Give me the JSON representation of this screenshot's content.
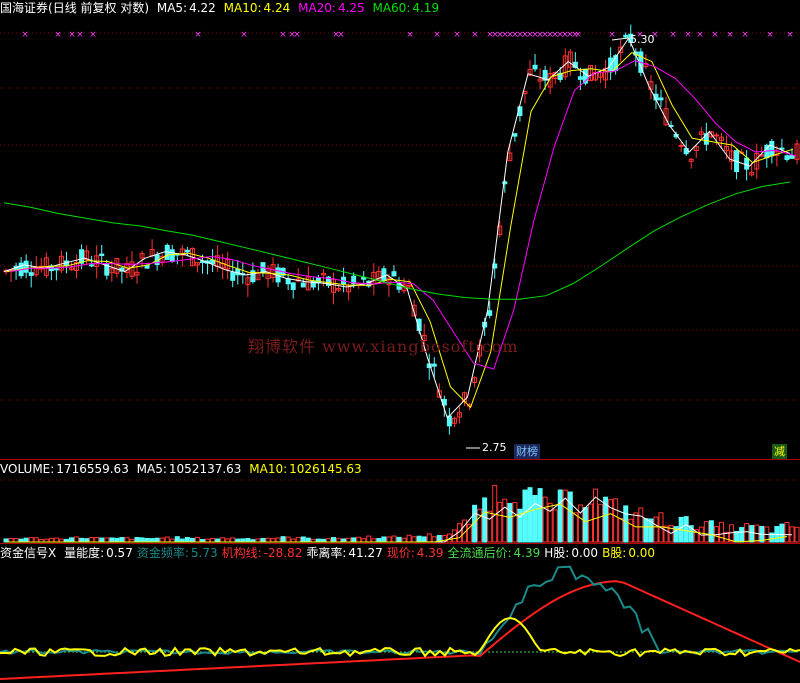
{
  "header": {
    "name": "国海证券",
    "period": "(日线 前复权 对数)",
    "ma5_label": "MA5:",
    "ma5_value": "4.22",
    "ma10_label": "MA10:",
    "ma10_value": "4.24",
    "ma20_label": "MA20:",
    "ma20_value": "4.25",
    "ma60_label": "MA60:",
    "ma60_value": "4.19"
  },
  "price_pane": {
    "high_label": "5.30",
    "low_label": "2.75",
    "tag_left": "财榜",
    "tag_right": "减",
    "watermark": "翔博软件 www.xiangbosoft.com"
  },
  "volume_header": {
    "volume_label": "VOLUME:",
    "volume_value": "1716559.63",
    "ma5_label": "MA5:",
    "ma5_value": "1052137.63",
    "ma10_label": "MA10:",
    "ma10_value": "1026145.63"
  },
  "indicator_header": {
    "name": "资金信号X",
    "items": [
      {
        "label": "量能度:",
        "value": "0.57",
        "color": "#ffffff"
      },
      {
        "label": "资金频率:",
        "value": "5.73",
        "color": "#1a8a8a"
      },
      {
        "label": "机构线:",
        "value": "-28.82",
        "color": "#ff3030"
      },
      {
        "label": "乖离率:",
        "value": "41.27",
        "color": "#ffffff"
      },
      {
        "label": "现价:",
        "value": "4.39",
        "color": "#ff3030"
      },
      {
        "label": "全流通后价:",
        "value": "4.39",
        "color": "#4cdc4c"
      },
      {
        "label": "H股:",
        "value": "0.00",
        "color": "#ffffff"
      },
      {
        "label": "B股:",
        "value": "0.00",
        "color": "#ffff00"
      }
    ]
  },
  "colors": {
    "up": "#ff3232",
    "down": "#54fcfc",
    "ma5": "#ffffff",
    "ma10": "#ffff00",
    "ma20": "#ff00ff",
    "ma60": "#00e000",
    "grid": "#8b0000",
    "signal": "#ff40ff"
  },
  "chart_data": [
    {
      "type": "candlestick",
      "title": "国海证券(日线 前复权 对数)",
      "scale": "log",
      "ylim": [
        2.75,
        5.3
      ],
      "grid": true,
      "annotations": [
        {
          "text": "5.30",
          "type": "high"
        },
        {
          "text": "2.75",
          "type": "low"
        }
      ],
      "series": [
        {
          "name": "MA5",
          "last": 4.22
        },
        {
          "name": "MA10",
          "last": 4.24
        },
        {
          "name": "MA20",
          "last": 4.25
        },
        {
          "name": "MA60",
          "last": 4.19
        }
      ],
      "ma60_points": [
        4.05,
        4.02,
        3.98,
        3.95,
        3.92,
        3.9,
        3.87,
        3.84,
        3.8,
        3.76,
        3.72,
        3.68,
        3.64,
        3.6,
        3.56,
        3.52,
        3.49,
        3.47,
        3.46,
        3.46,
        3.48,
        3.55,
        3.65,
        3.76,
        3.87,
        3.96,
        4.04,
        4.11,
        4.16,
        4.19
      ],
      "close_points": [
        3.62,
        3.66,
        3.64,
        3.67,
        3.7,
        3.66,
        3.62,
        3.7,
        3.74,
        3.72,
        3.68,
        3.63,
        3.6,
        3.62,
        3.58,
        3.56,
        3.55,
        3.53,
        3.55,
        3.6,
        3.52,
        3.15,
        2.85,
        2.95,
        3.4,
        4.4,
        5.0,
        4.95,
        5.1,
        4.98,
        5.05,
        5.3,
        4.9,
        4.6,
        4.4,
        4.55,
        4.35,
        4.3,
        4.45,
        4.39
      ]
    },
    {
      "type": "bar",
      "title": "VOLUME",
      "series": [
        {
          "name": "VOLUME",
          "last": 1716559.63
        },
        {
          "name": "MA5",
          "last": 1052137.63
        },
        {
          "name": "MA10",
          "last": 1026145.63
        }
      ],
      "values": [
        0.06,
        0.07,
        0.06,
        0.07,
        0.08,
        0.06,
        0.07,
        0.06,
        0.08,
        0.07,
        0.06,
        0.07,
        0.06,
        0.07,
        0.08,
        0.07,
        0.06,
        0.07,
        0.09,
        0.08,
        0.1,
        0.12,
        0.15,
        0.4,
        0.85,
        1.0,
        0.8,
        0.7,
        0.75,
        0.9,
        0.65,
        0.55,
        0.45,
        0.4,
        0.35,
        0.3,
        0.25,
        0.28,
        0.22,
        0.3
      ]
    },
    {
      "type": "line",
      "title": "资金信号X",
      "series": [
        {
          "name": "量能度",
          "last": 0.57
        },
        {
          "name": "资金频率",
          "last": 5.73
        },
        {
          "name": "机构线",
          "last": -28.82
        },
        {
          "name": "乖离率",
          "last": 41.27
        }
      ]
    }
  ]
}
